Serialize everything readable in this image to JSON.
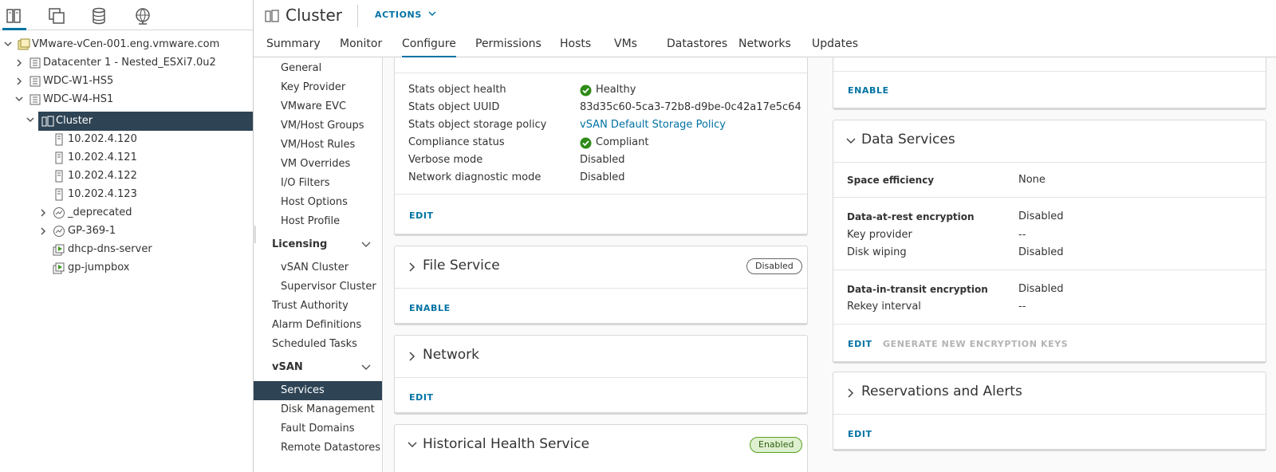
{
  "nav_tabs": [
    {
      "name": "hosts-clusters-tab",
      "icon": "hosts-and-clusters-icon"
    },
    {
      "name": "vms-templates-tab",
      "icon": "vms-and-templates-icon"
    },
    {
      "name": "storage-tab",
      "icon": "storage-icon"
    },
    {
      "name": "networking-tab",
      "icon": "networking-icon"
    }
  ],
  "tree": {
    "vcenter": "VMware-vCen-001.eng.vmware.com",
    "dc1": "Datacenter 1 - Nested_ESXi7.0u2",
    "dc2": "WDC-W1-HS5",
    "dc3": "WDC-W4-HS1",
    "cluster": "Cluster",
    "host1": "10.202.4.120",
    "host2": "10.202.4.121",
    "host3": "10.202.4.122",
    "host4": "10.202.4.123",
    "pool1": "_deprecated",
    "pool2": "GP-369-1",
    "vm1": "dhcp-dns-server",
    "vm2": "gp-jumpbox"
  },
  "header": {
    "title": "Cluster",
    "actions": "ACTIONS"
  },
  "tabs": [
    "Summary",
    "Monitor",
    "Configure",
    "Permissions",
    "Hosts",
    "VMs",
    "Datastores",
    "Networks",
    "Updates"
  ],
  "config_nav": {
    "general": "General",
    "key_provider": "Key Provider",
    "vmware_evc": "VMware EVC",
    "vm_host_groups": "VM/Host Groups",
    "vm_host_rules": "VM/Host Rules",
    "vm_overrides": "VM Overrides",
    "io_filters": "I/O Filters",
    "host_options": "Host Options",
    "host_profile": "Host Profile",
    "licensing": "Licensing",
    "vsan_cluster": "vSAN Cluster",
    "supervisor_cluster": "Supervisor Cluster",
    "trust_authority": "Trust Authority",
    "alarm_definitions": "Alarm Definitions",
    "scheduled_tasks": "Scheduled Tasks",
    "vsan": "vSAN",
    "services": "Services",
    "disk_management": "Disk Management",
    "fault_domains": "Fault Domains",
    "remote_datastores": "Remote Datastores"
  },
  "perf_card": {
    "rows": [
      {
        "label": "Stats object health",
        "value": "Healthy",
        "status": "check"
      },
      {
        "label": "Stats object UUID",
        "value": "83d35c60-5ca3-72b8-d9be-0c42a17e5c64"
      },
      {
        "label": "Stats object storage policy",
        "value": "vSAN Default Storage Policy",
        "link": true
      },
      {
        "label": "Compliance status",
        "value": "Compliant",
        "status": "check"
      },
      {
        "label": "Verbose mode",
        "value": "Disabled"
      },
      {
        "label": "Network diagnostic mode",
        "value": "Disabled"
      }
    ],
    "edit": "EDIT"
  },
  "file_service": {
    "title": "File Service",
    "badge": "Disabled",
    "action": "ENABLE"
  },
  "network": {
    "title": "Network",
    "action": "EDIT"
  },
  "historical": {
    "title": "Historical Health Service",
    "badge": "Enabled"
  },
  "top_right_card": {
    "action": "ENABLE"
  },
  "data_services": {
    "title": "Data Services",
    "space_efficiency_label": "Space efficiency",
    "space_efficiency_value": "None",
    "dar_label": "Data-at-rest encryption",
    "dar_value": "Disabled",
    "key_provider_label": "Key provider",
    "key_provider_value": "--",
    "disk_wiping_label": "Disk wiping",
    "disk_wiping_value": "Disabled",
    "dit_label": "Data-in-transit encryption",
    "dit_value": "Disabled",
    "rekey_label": "Rekey interval",
    "rekey_value": "--",
    "edit": "EDIT",
    "generate": "GENERATE NEW ENCRYPTION KEYS"
  },
  "reservations": {
    "title": "Reservations and Alerts",
    "action": "EDIT"
  },
  "colors": {
    "accent": "#0072a3",
    "selected_bg": "#2e4455",
    "healthy": "#2e8b17"
  }
}
